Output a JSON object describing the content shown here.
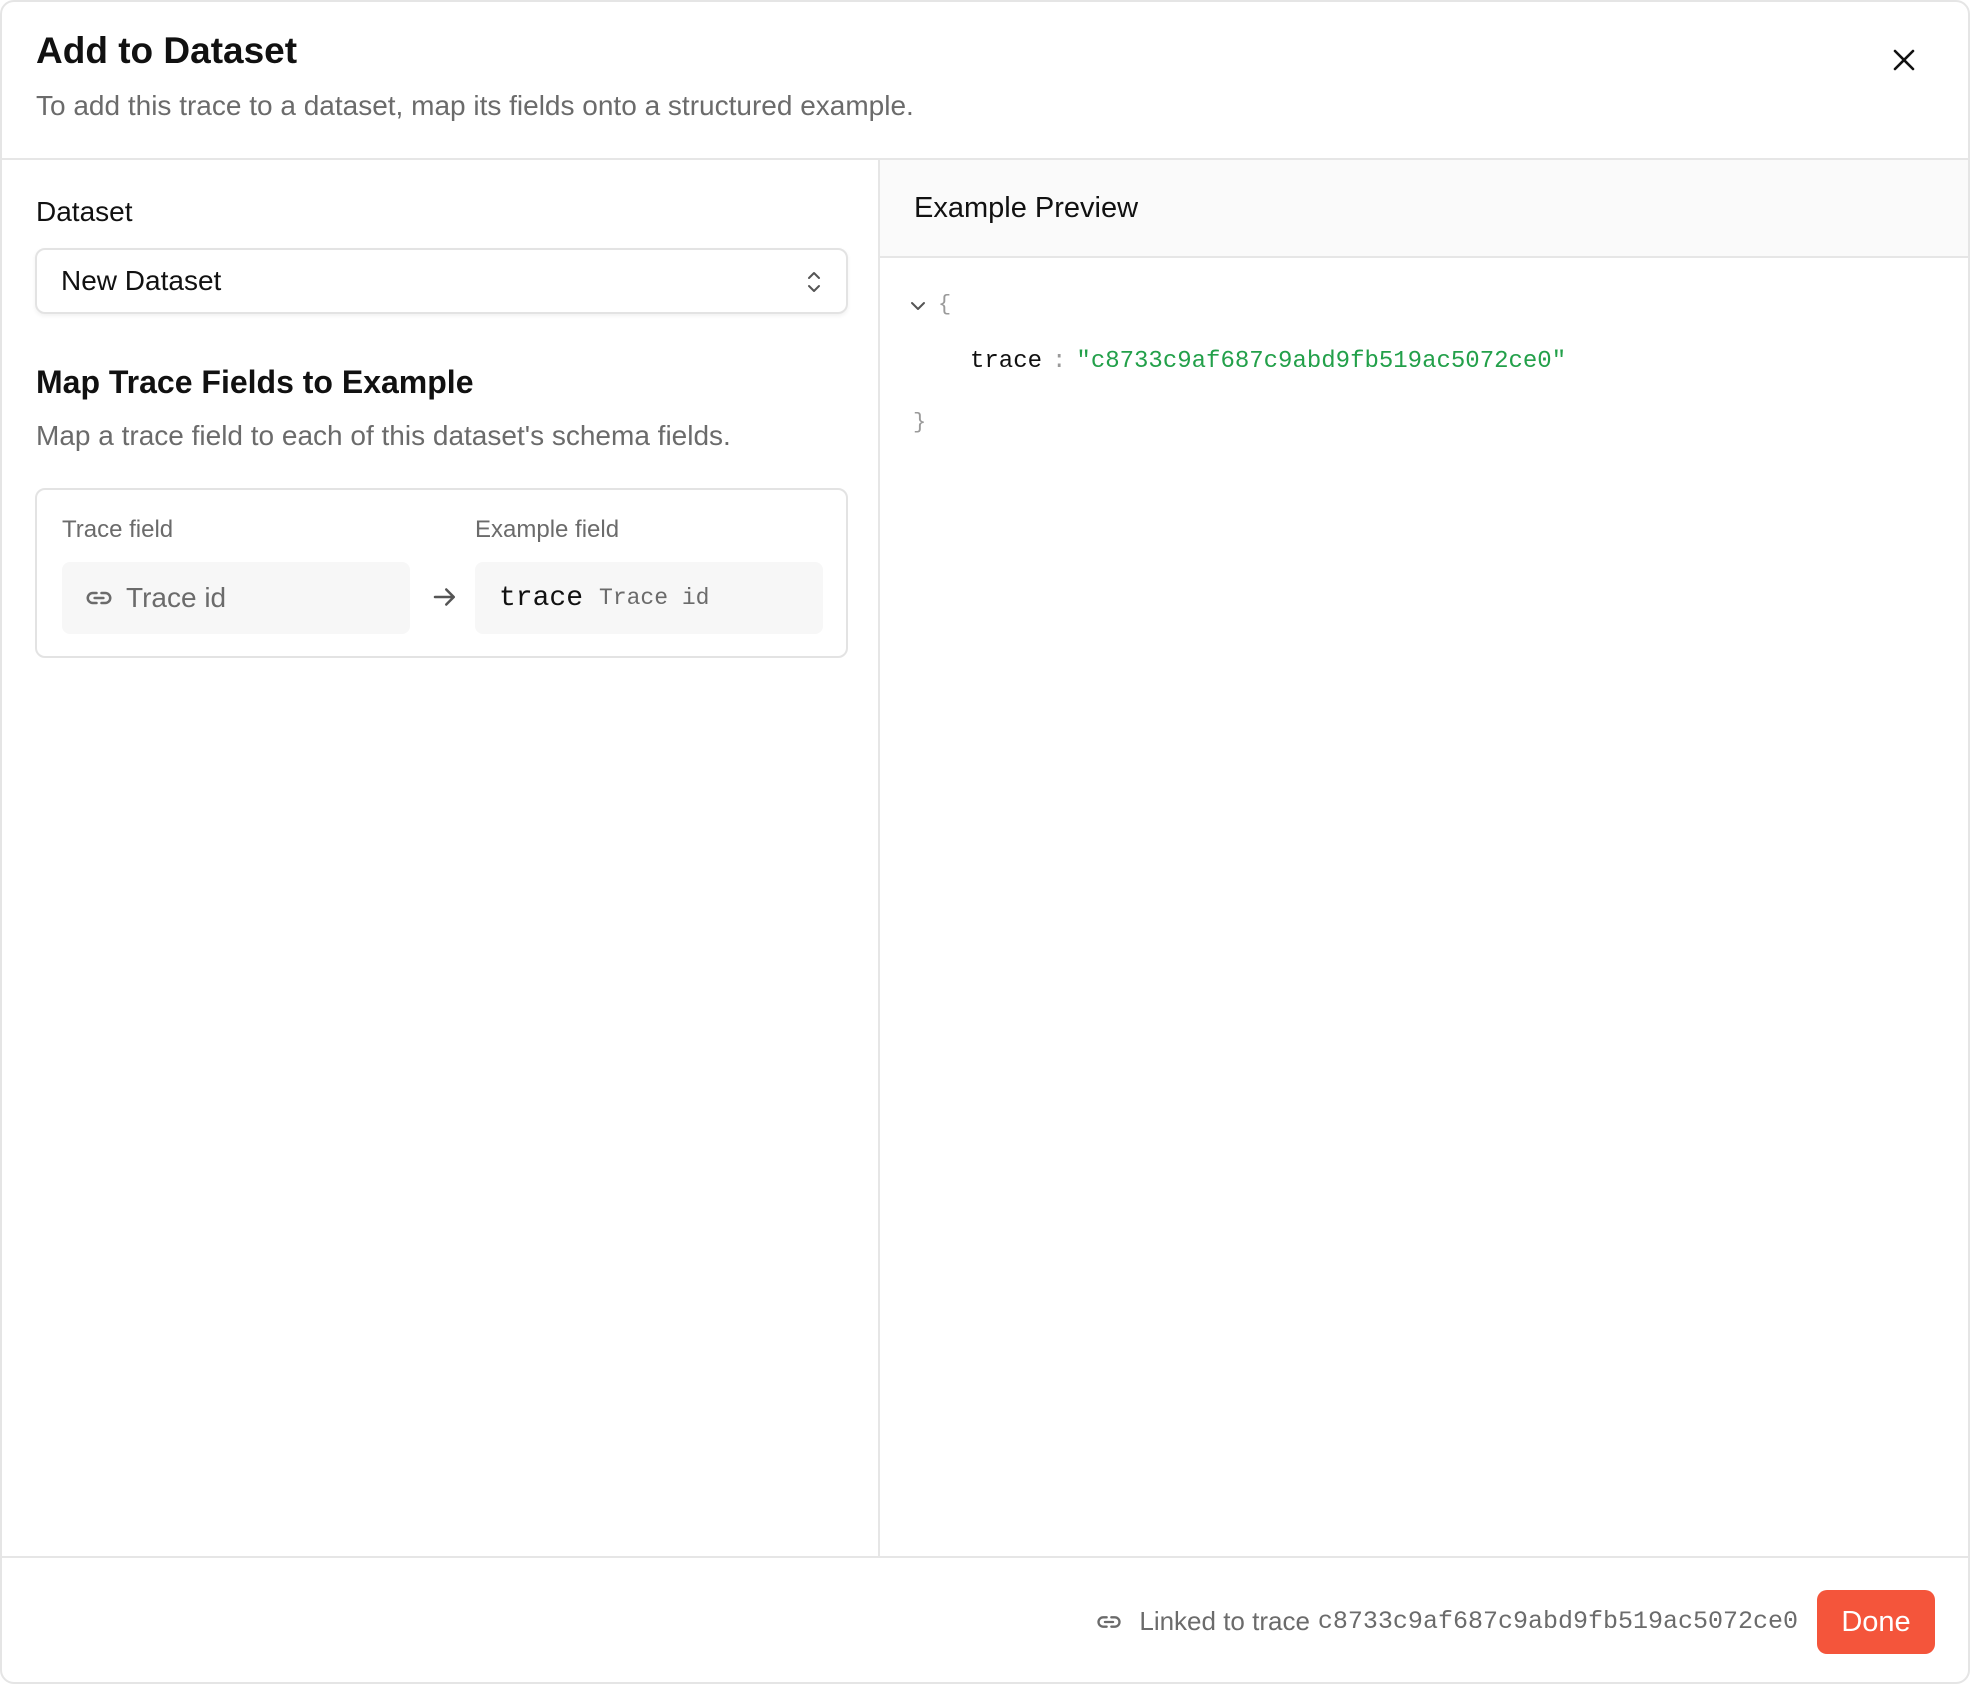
{
  "dialog": {
    "title": "Add to Dataset",
    "subtitle": "To add this trace to a dataset, map its fields onto a structured example."
  },
  "dataset": {
    "label": "Dataset",
    "selected": "New Dataset"
  },
  "mapping": {
    "title": "Map Trace Fields to Example",
    "description": "Map a trace field to each of this dataset's schema fields.",
    "trace_field_header": "Trace field",
    "example_field_header": "Example field",
    "rows": [
      {
        "trace_field": "Trace id",
        "example_key": "trace",
        "example_type": "Trace id"
      }
    ]
  },
  "preview": {
    "title": "Example Preview",
    "open_brace": "{",
    "close_brace": "}",
    "entries": [
      {
        "key": "trace",
        "colon": ":",
        "value": "\"c8733c9af687c9abd9fb519ac5072ce0\""
      }
    ]
  },
  "footer": {
    "linked_prefix": "Linked to trace",
    "trace_id": "c8733c9af687c9abd9fb519ac5072ce0",
    "done_label": "Done"
  },
  "colors": {
    "accent": "#f4553b",
    "json_string": "#23a04a",
    "muted_text": "#6b6b6b",
    "border": "#e6e6e6"
  },
  "icons": {
    "close": "close-icon",
    "select_chevrons": "chevron-up-down-icon",
    "link": "link-icon",
    "arrow": "arrow-right-icon",
    "collapse": "chevron-down-icon"
  }
}
